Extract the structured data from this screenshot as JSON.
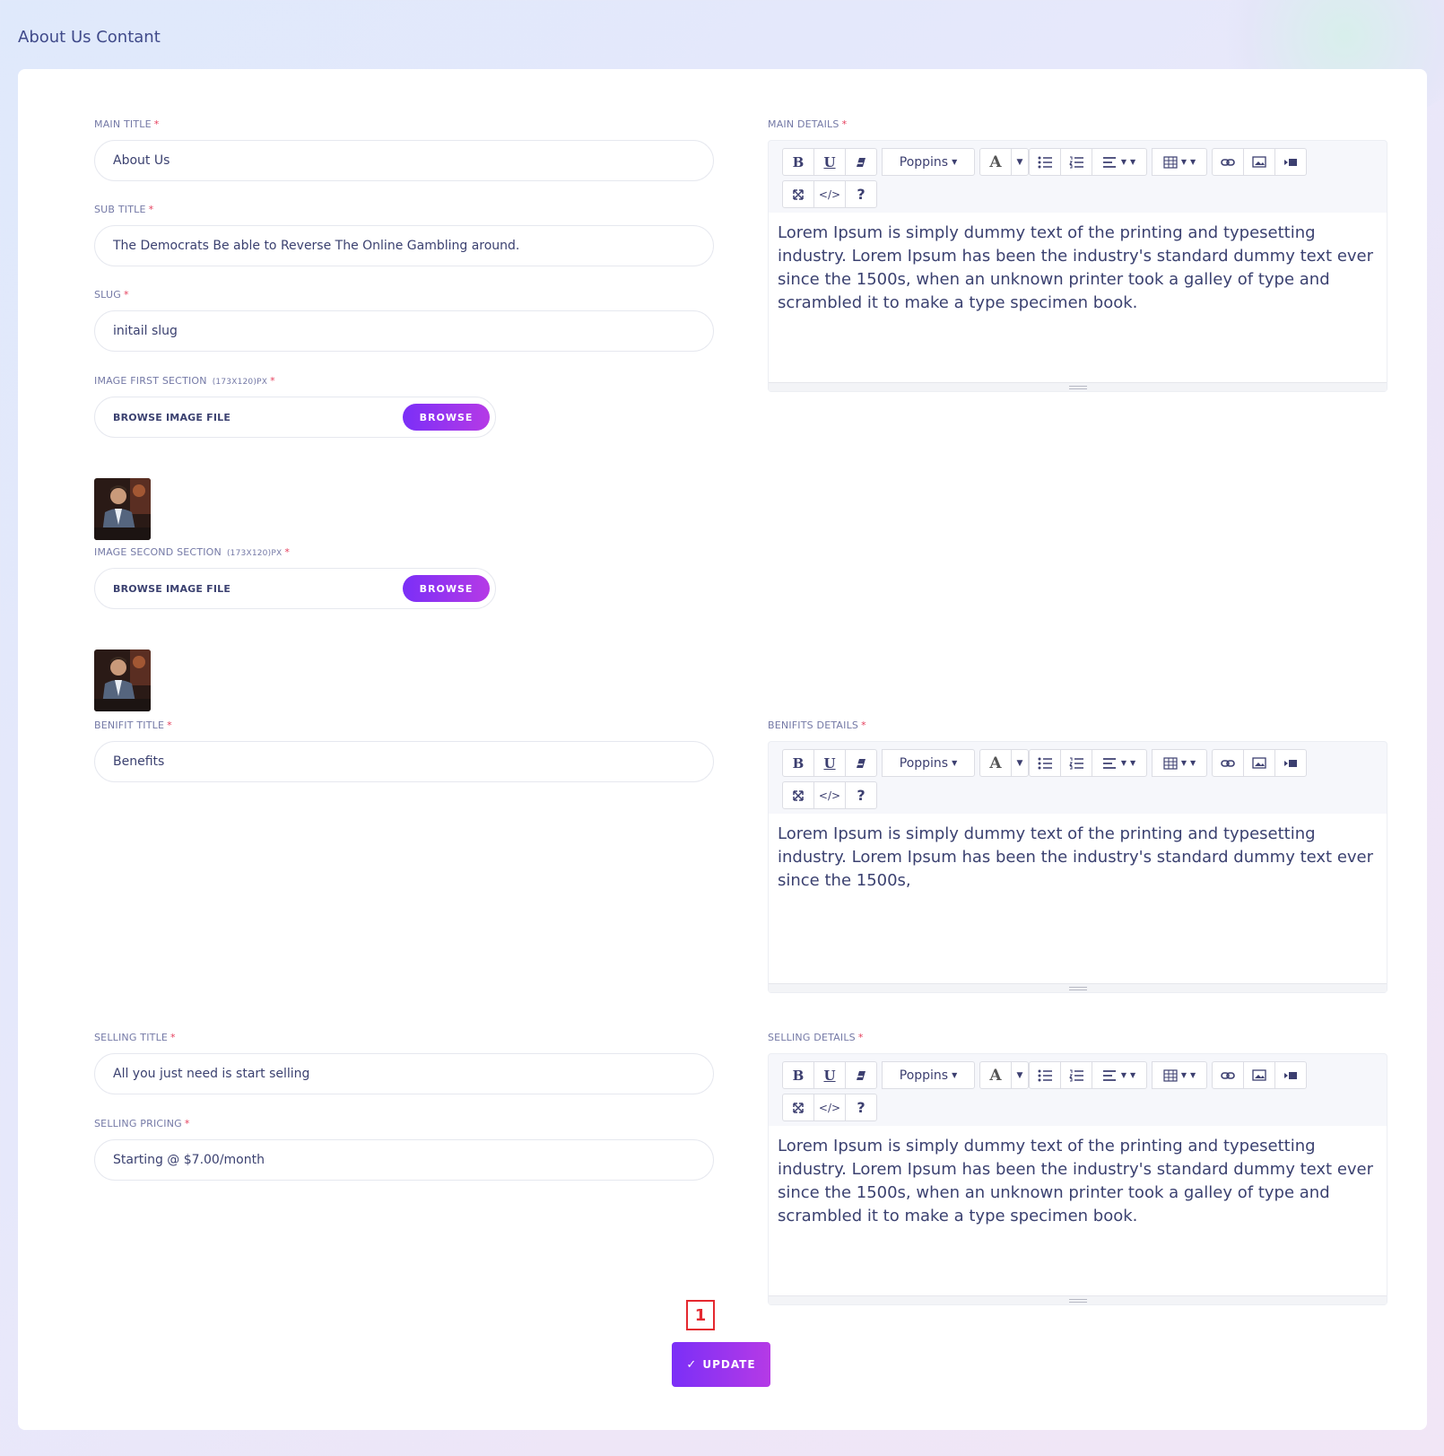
{
  "page": {
    "title": "About Us Contant"
  },
  "fields": {
    "main_title": {
      "label": "MAIN TITLE",
      "value": "About Us"
    },
    "sub_title": {
      "label": "SUB TITLE",
      "value": "The Democrats Be able to Reverse The Online Gambling around."
    },
    "slug": {
      "label": "SLUG",
      "value": "initail slug"
    },
    "image_first": {
      "label": "IMAGE FIRST SECTION",
      "dim": "(173x120)px",
      "file_text": "BROWSE IMAGE FILE",
      "browse": "BROWSE"
    },
    "image_second": {
      "label": "IMAGE SECOND SECTION",
      "dim": "(173x120)px",
      "file_text": "BROWSE IMAGE FILE",
      "browse": "BROWSE"
    },
    "benifit_title": {
      "label": "BENIFIT TITLE",
      "value": "Benefits"
    },
    "selling_title": {
      "label": "SELLING TITLE",
      "value": "All you just need is start selling"
    },
    "selling_pricing": {
      "label": "SELLING PRICING",
      "value": "Starting @ $7.00/month"
    },
    "required_mark": "*"
  },
  "editors": {
    "main_details": {
      "label": "MAIN DETAILS",
      "content": "Lorem Ipsum is simply dummy text of the printing and typesetting industry. Lorem Ipsum has been the industry's standard dummy text ever since the 1500s, when an unknown printer took a galley of type and scrambled it to make a type specimen book."
    },
    "benefits_details": {
      "label": "BENIFITS DETAILS",
      "content": " Lorem Ipsum is simply dummy text of the printing and typesetting industry. Lorem Ipsum has been the industry's standard dummy text ever since the 1500s,"
    },
    "selling_details": {
      "label": "SELLING DETAILS",
      "content": "Lorem Ipsum is simply dummy text of the printing and typesetting industry. Lorem Ipsum has been the industry's standard dummy text ever since the 1500s, when an unknown printer took a galley of type and scrambled it to make a type specimen book."
    }
  },
  "toolbar": {
    "bold": "B",
    "underline": "U",
    "font": "Poppins",
    "color": "A",
    "code": "</>",
    "help": "?"
  },
  "actions": {
    "update": "UPDATE",
    "update_icon": "✓"
  },
  "annotation": {
    "marker": "1"
  },
  "colors": {
    "accent_start": "#7b2ff7",
    "accent_end": "#b53ae6",
    "required": "#e53e5c",
    "text": "#3b4170"
  }
}
